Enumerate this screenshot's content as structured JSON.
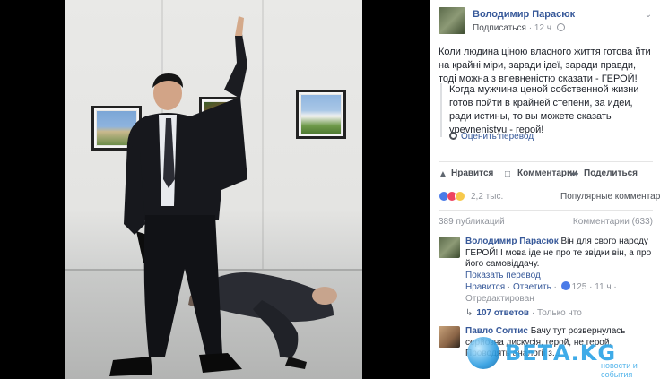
{
  "post": {
    "author": "Володимир Парасюк",
    "subscribe": "Подписаться",
    "time": "12 ч",
    "text": "Коли людина ціною власного життя готова йти на крайні міри, заради ідеї, заради правди, тоді можна з впевненістю сказати - ГЕРОЙ!",
    "translation": "Когда мужчина ценой собственной жизни готов пойти в крайней степени, за идеи, ради истины, то вы можете сказать vpevnenistyu - герой!",
    "see_translation": "Оценить перевод"
  },
  "actions": {
    "like": "Нравится",
    "comment": "Комментарии",
    "share": "Поделиться"
  },
  "reactions": {
    "count": "2,2 тыс.",
    "sort": "Популярные комментарии"
  },
  "stats": {
    "publications": "389 публикаций",
    "comments": "Комментарии (633)"
  },
  "comments": [
    {
      "author": "Володимир Парасюк",
      "text": "Він для свого народу ГЕРОЙ! І мова іде не про те звідки він, а про його самовіддачу.",
      "translate": "Показать перевод",
      "like": "Нравится",
      "reply": "Ответить",
      "likes": "125",
      "time": "11 ч",
      "edited": "Отредактирован",
      "replies": "107 ответов",
      "replies_time": "Только что"
    },
    {
      "author": "Павло Солтис",
      "text": "Бачу тут розвернулась серйозна дискусія, герой, не герой. Проводять аналогії з..."
    }
  ],
  "watermark": {
    "brand": "ВЕТА.KG",
    "tagline": "новости и события"
  }
}
